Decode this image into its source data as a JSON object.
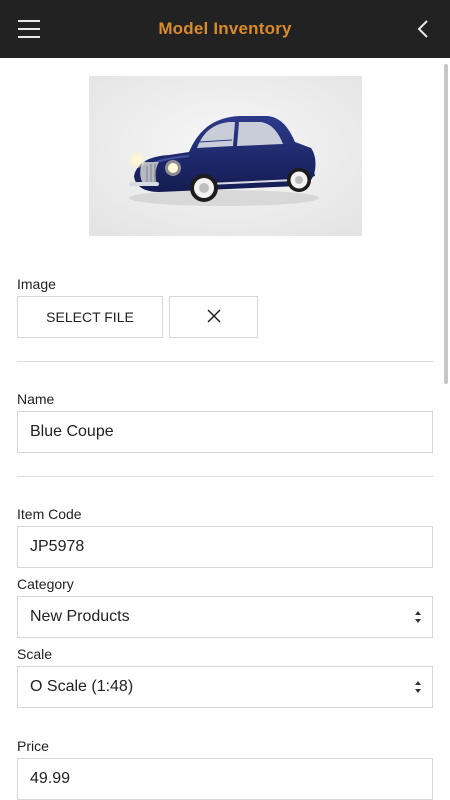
{
  "header": {
    "title": "Model Inventory",
    "title_color": "#d98a2b",
    "background": "#222222",
    "menu_icon": "hamburger-icon",
    "back_icon": "chevron-left-icon"
  },
  "image_section": {
    "label": "Image",
    "select_file_label": "SELECT FILE",
    "clear_icon": "close-icon"
  },
  "name": {
    "label": "Name",
    "value": "Blue Coupe"
  },
  "item_code": {
    "label": "Item Code",
    "value": "JP5978"
  },
  "category": {
    "label": "Category",
    "value": "New Products"
  },
  "scale": {
    "label": "Scale",
    "value": "O Scale (1:48)"
  },
  "price": {
    "label": "Price",
    "value": "49.99"
  }
}
